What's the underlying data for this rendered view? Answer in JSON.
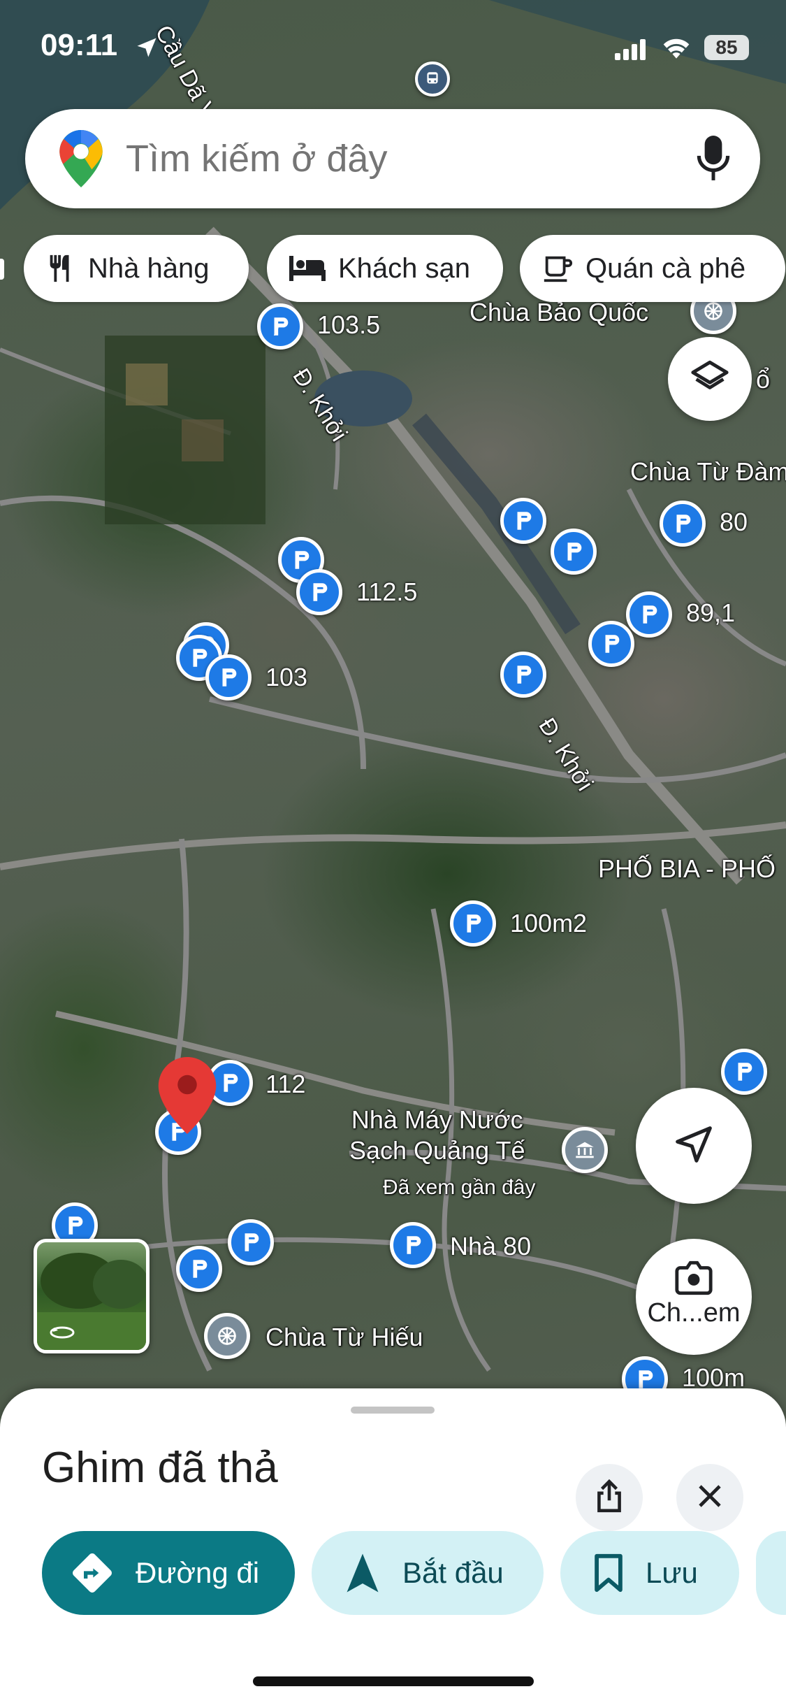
{
  "status_bar": {
    "time": "09:11",
    "battery": "85"
  },
  "search": {
    "placeholder": "Tìm kiếm ở đây"
  },
  "chips": [
    {
      "label": "Nhà hàng",
      "icon": "fork-knife-icon"
    },
    {
      "label": "Khách sạn",
      "icon": "bed-icon"
    },
    {
      "label": "Quán cà phê",
      "icon": "coffee-cup-icon"
    }
  ],
  "map": {
    "street_labels": [
      "Cầu Dã Viên",
      "Đ. Khởi",
      "Đ. Khởi"
    ],
    "place_labels": {
      "chua_bao_quoc": "Chùa Bảo Quốc",
      "chua_tu_dam": "Chùa Từ Đàm",
      "pho_bia": "PHỐ BIA - PHỐ",
      "nha_may_nuoc": "Nhà Máy Nước\nSạch Quảng Tế",
      "nha_may_nuoc_sub": "Đã xem gần đây",
      "chua_tu_hieu": "Chùa Từ Hiếu",
      "edge_char": "ổ"
    },
    "pin_labels": [
      "103.5",
      "80",
      "112.5",
      "89,1",
      "103",
      "100m2",
      "112",
      "Nhà 80",
      "100m"
    ],
    "thumbnail_alt": "Street View"
  },
  "camera_button": {
    "label": "Ch...em"
  },
  "sheet": {
    "title": "Ghim đã thả",
    "actions": {
      "directions": "Đường đi",
      "start": "Bắt đầu",
      "save": "Lưu"
    }
  },
  "colors": {
    "accent_teal": "#0b7a85",
    "light_teal": "#d3f1f5",
    "pin_blue": "#1e7ae6",
    "red_marker": "#e53935"
  }
}
